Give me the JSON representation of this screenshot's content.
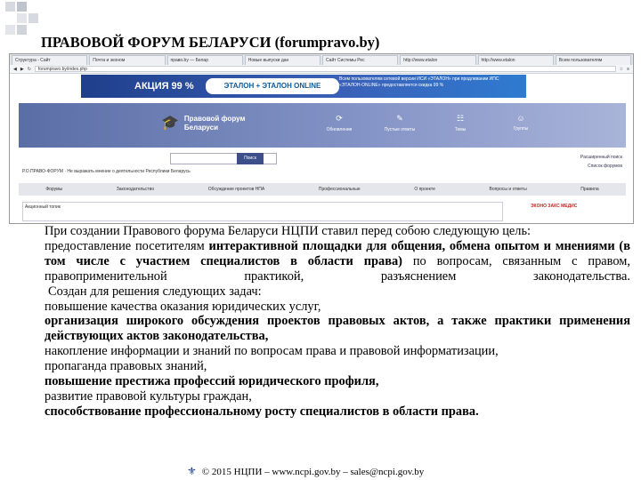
{
  "slide": {
    "title": "ПРАВОВОЙ ФОРУМ БЕЛАРУСИ (forumpravo.by)"
  },
  "browser": {
    "tabs": [
      "Структура - Сайт",
      "Почта и эконом",
      "право.by — Белар",
      "Новые выпуски дан",
      "Сайт Системы Рес",
      "http://www.etalon",
      "http://www.etalon",
      "Всем пользователям"
    ],
    "address": "forumpravo.by/index.php"
  },
  "banner": {
    "action": "АКЦИЯ 99 %",
    "logo": "ЭТАЛОН + ЭТАЛОН ONLINE",
    "text": "Всем пользователям сетевой версии ИСИ «ЭТАЛОН» при продлевании ИПС «ЭТАЛОН-ONLINE» предоставляется скидка 99 %"
  },
  "site": {
    "logo_line1": "Правовой форум",
    "logo_line2": "Беларуси",
    "nav": [
      "Обновления",
      "Пустые ответы",
      "Темы",
      "Группы"
    ],
    "search_button": "Поиск",
    "crumb": "Р.О.ПРАВО-ФОРУМ · Не выражать мнение о деятельности Республики Беларусь",
    "right_links": [
      "Расширенный поиск",
      "Список форумов"
    ],
    "menu": [
      "Форумы",
      "Законодательство",
      "Обсуждение проектов НПА",
      "Профессиональные",
      "О проекте",
      "Вопросы и ответы",
      "Правила"
    ],
    "announce": "Акционный топик",
    "ad": "ЭКОНО ЗАКС МЕДИС"
  },
  "text": {
    "intro": "При создании Правового форума Беларуси НЦПИ ставил перед собою следующую цель:",
    "goal_plain": "предоставление посетителям ",
    "goal_bold": "интерактивной площадки для общения, обмена опытом и мнениями (в том числе с участием специалистов в области права)",
    "goal_rest": " по вопросам, связанным с правом, правоприменительной практикой, разъяснением законодательства.",
    "tasks_intro": "Создан для решения следующих задач:",
    "tasks": [
      {
        "text": "повышение качества оказания юридических услуг,",
        "bold": false
      },
      {
        "text": "организация широкого обсуждения проектов правовых актов, а также практики применения действующих актов законодательства,",
        "bold": true
      },
      {
        "text": "накопление информации и знаний по вопросам права и правовой информатизации,",
        "bold": false
      },
      {
        "text": "пропаганда правовых знаний,",
        "bold": false
      },
      {
        "text": "повышение престижа профессий юридического профиля,",
        "bold": true
      },
      {
        "text": "развитие правовой культуры граждан,",
        "bold": false
      },
      {
        "text": "способствование профессиональному росту специалистов в области права.",
        "bold": true
      }
    ]
  },
  "footer": "© 2015 НЦПИ – www.ncpi.gov.by – sales@ncpi.gov.by"
}
